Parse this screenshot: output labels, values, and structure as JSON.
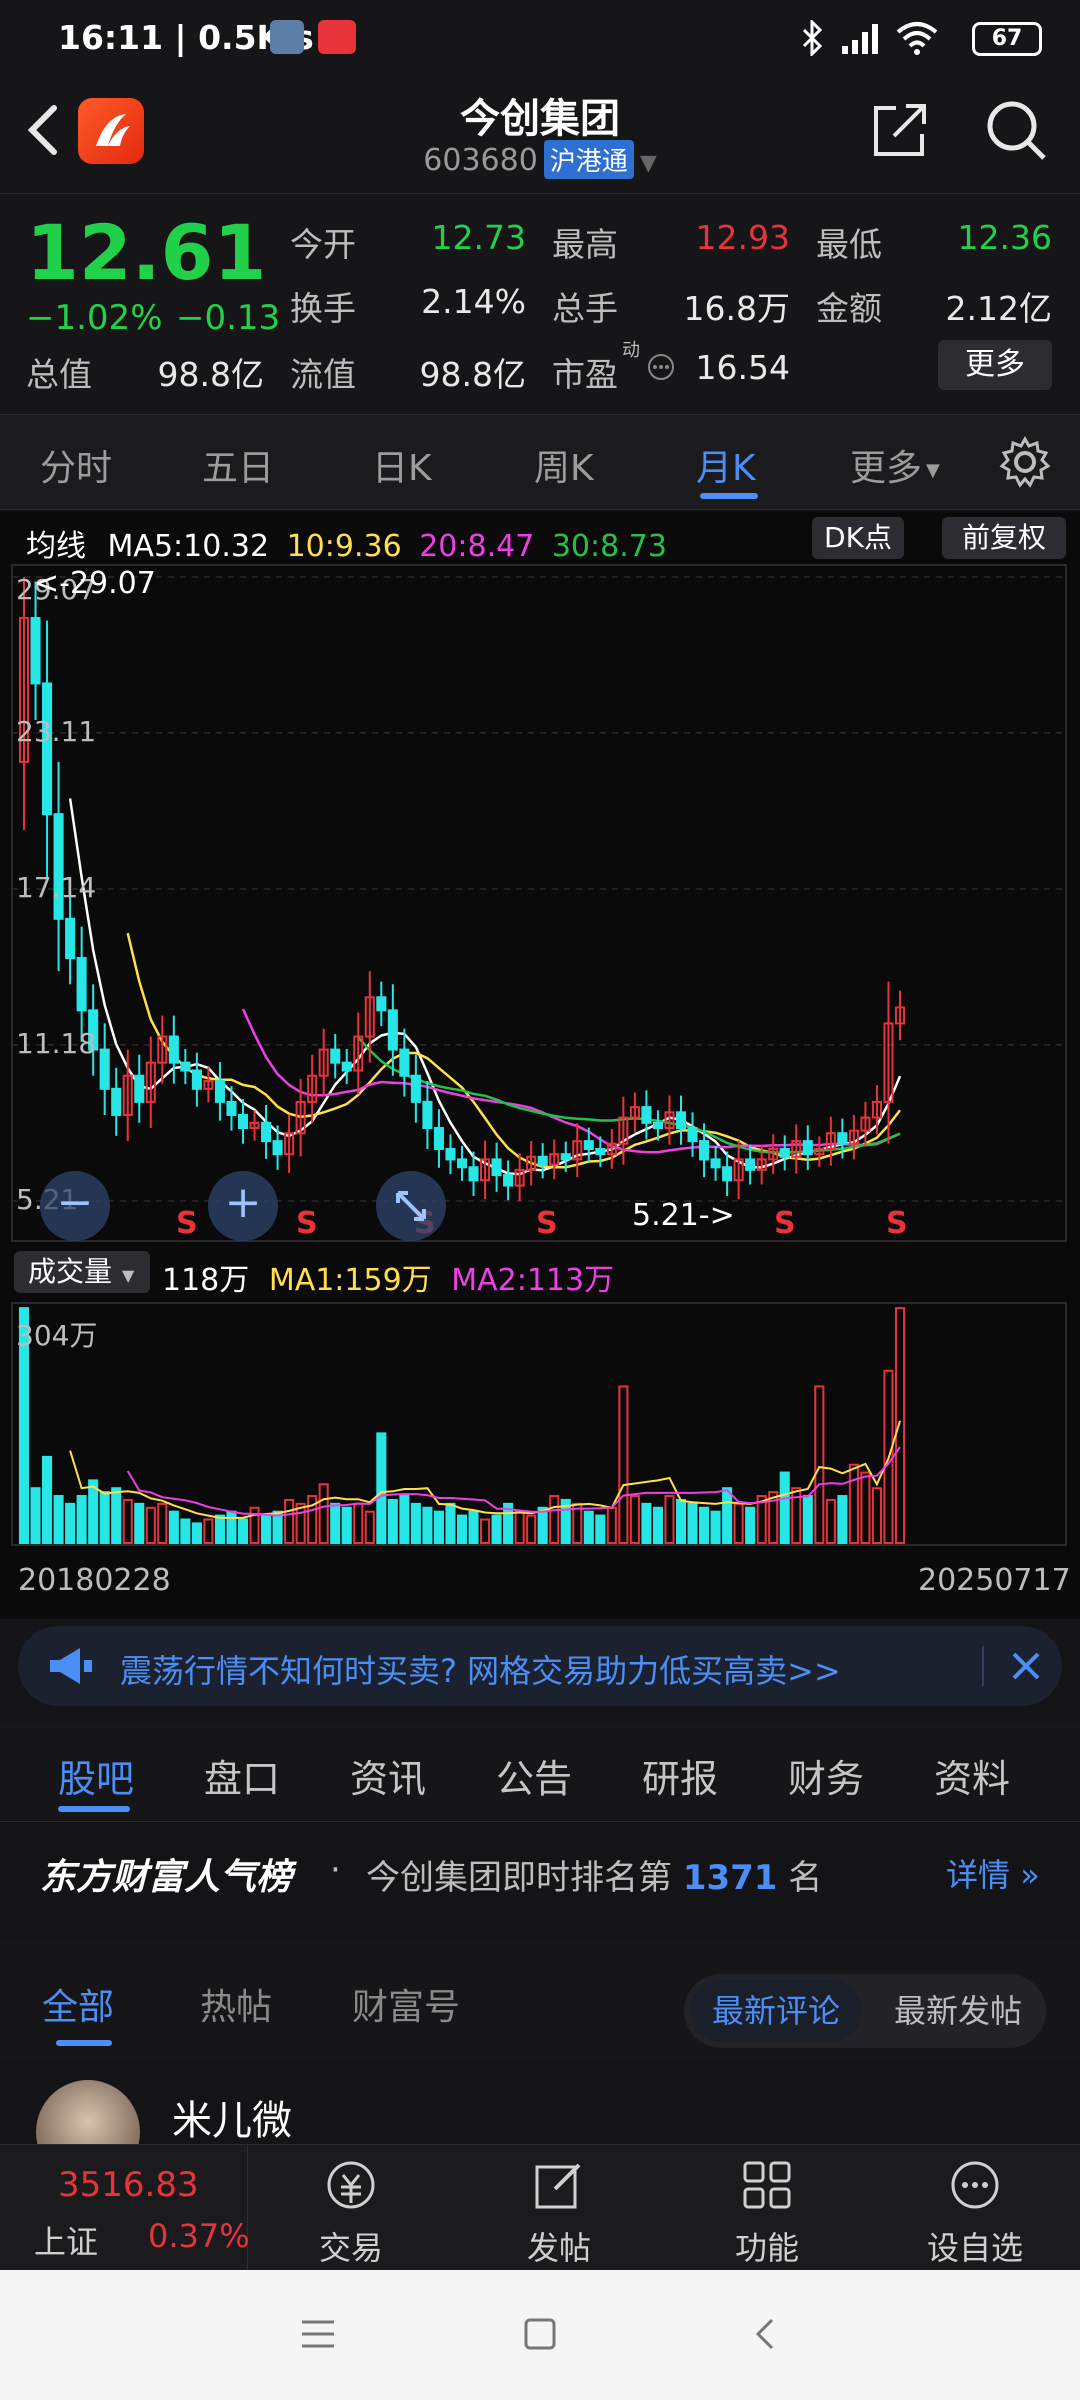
{
  "status_bar": {
    "time": "16:11 | 0.5K/s",
    "battery": "67"
  },
  "header": {
    "title": "今创集团",
    "code": "603680",
    "tag": "沪港通"
  },
  "quote": {
    "price": "12.61",
    "change_pct": "−1.02%",
    "change": "−0.13",
    "fields": [
      {
        "label": "今开",
        "value": "12.73",
        "color": "#22d14a"
      },
      {
        "label": "最高",
        "value": "12.93",
        "color": "#e8333a"
      },
      {
        "label": "最低",
        "value": "12.36",
        "color": "#22d14a"
      },
      {
        "label": "换手",
        "value": "2.14%",
        "color": "#e8e8e8"
      },
      {
        "label": "总手",
        "value": "16.8万",
        "color": "#e8e8e8"
      },
      {
        "label": "金额",
        "value": "2.12亿",
        "color": "#e8e8e8"
      },
      {
        "label": "总值",
        "value": "98.8亿",
        "color": "#e8e8e8"
      },
      {
        "label": "流值",
        "value": "98.8亿",
        "color": "#e8e8e8"
      },
      {
        "label": "市盈",
        "value": "16.54",
        "color": "#e8e8e8"
      }
    ],
    "pe_superscript": "动",
    "more_button": "更多"
  },
  "period_tabs": [
    "分时",
    "五日",
    "日K",
    "周K",
    "月K",
    "更多"
  ],
  "active_period": "月K",
  "chart_legend": {
    "avg": "均线",
    "ma5": "MA5:10.32",
    "ma10": "10:9.36",
    "ma20": "20:8.47",
    "ma30": "30:8.73",
    "dk_button": "DK点",
    "adjust_button": "前复权"
  },
  "volume_legend": {
    "button": "成交量",
    "vol": "118万",
    "ma1": "MA1:159万",
    "ma2": "MA2:113万"
  },
  "chart_annotations": {
    "high_marker": "<-29.07",
    "low_marker": "5.21->",
    "sell_marker": "S"
  },
  "chart_data": [
    {
      "type": "candlestick",
      "title": "",
      "y_ticks": [
        "29.07",
        "23.11",
        "17.14",
        "11.18",
        "5.21"
      ],
      "ylim": [
        5.21,
        29.07
      ],
      "x_start_label": "20180228",
      "x_end_label": "20250717",
      "colors": {
        "up": "#e8333a",
        "down": "#26e6e6",
        "ma5": "#ffffff",
        "ma10": "#ffe04a",
        "ma20": "#ee3ee6",
        "ma30": "#22c24a"
      },
      "closes": [
        27.5,
        25.0,
        20.0,
        16.0,
        14.5,
        12.5,
        11.0,
        9.5,
        8.5,
        10.0,
        9.0,
        10.5,
        11.5,
        10.5,
        10.2,
        9.5,
        9.8,
        9.0,
        8.5,
        8.0,
        8.2,
        7.5,
        7.0,
        7.8,
        9.0,
        10.0,
        11.0,
        10.5,
        10.2,
        11.5,
        13.0,
        12.5,
        11.0,
        10.0,
        9.0,
        8.0,
        7.2,
        6.8,
        6.5,
        6.0,
        6.8,
        6.2,
        5.8,
        6.4,
        6.9,
        6.6,
        7.0,
        6.8,
        7.5,
        7.2,
        7.0,
        7.4,
        8.4,
        8.8,
        8.2,
        8.0,
        8.6,
        8.0,
        7.5,
        6.8,
        6.5,
        6.0,
        6.8,
        6.4,
        6.8,
        7.2,
        6.9,
        7.5,
        7.0,
        7.2,
        7.8,
        7.4,
        7.9,
        8.4,
        9.0,
        12.0,
        12.61
      ],
      "volume_ticks": [
        "304万"
      ],
      "volumes": [
        300,
        70,
        110,
        60,
        50,
        60,
        80,
        65,
        70,
        55,
        50,
        45,
        50,
        40,
        30,
        25,
        30,
        35,
        40,
        30,
        45,
        35,
        40,
        55,
        50,
        60,
        75,
        50,
        45,
        50,
        40,
        140,
        55,
        60,
        50,
        45,
        40,
        50,
        35,
        40,
        30,
        35,
        50,
        40,
        35,
        45,
        60,
        55,
        50,
        40,
        35,
        45,
        200,
        60,
        50,
        45,
        60,
        55,
        50,
        45,
        40,
        70,
        50,
        45,
        60,
        65,
        90,
        70,
        60,
        200,
        55,
        60,
        100,
        90,
        70,
        220,
        300
      ]
    }
  ],
  "nav_buttons": {
    "zoom_out": "−",
    "zoom_in": "+"
  },
  "banner": {
    "text": "震荡行情不知何时买卖? 网格交易助力低买高卖>>"
  },
  "content_tabs": [
    "股吧",
    "盘口",
    "资讯",
    "公告",
    "研报",
    "财务",
    "资料"
  ],
  "rank": {
    "brand": "东方财富人气榜",
    "dot": "·",
    "text": "今创集团即时排名第",
    "number": "1371",
    "suffix": "名",
    "detail": "详情"
  },
  "post_filters": [
    "全部",
    "热帖",
    "财富号"
  ],
  "sort_options": [
    "最新评论",
    "最新发帖"
  ],
  "post": {
    "username": "米儿微"
  },
  "bottom_nav": {
    "index_value": "3516.83",
    "index_name": "上证",
    "index_pct": "0.37%",
    "items": [
      "交易",
      "发帖",
      "功能",
      "设自选"
    ]
  }
}
